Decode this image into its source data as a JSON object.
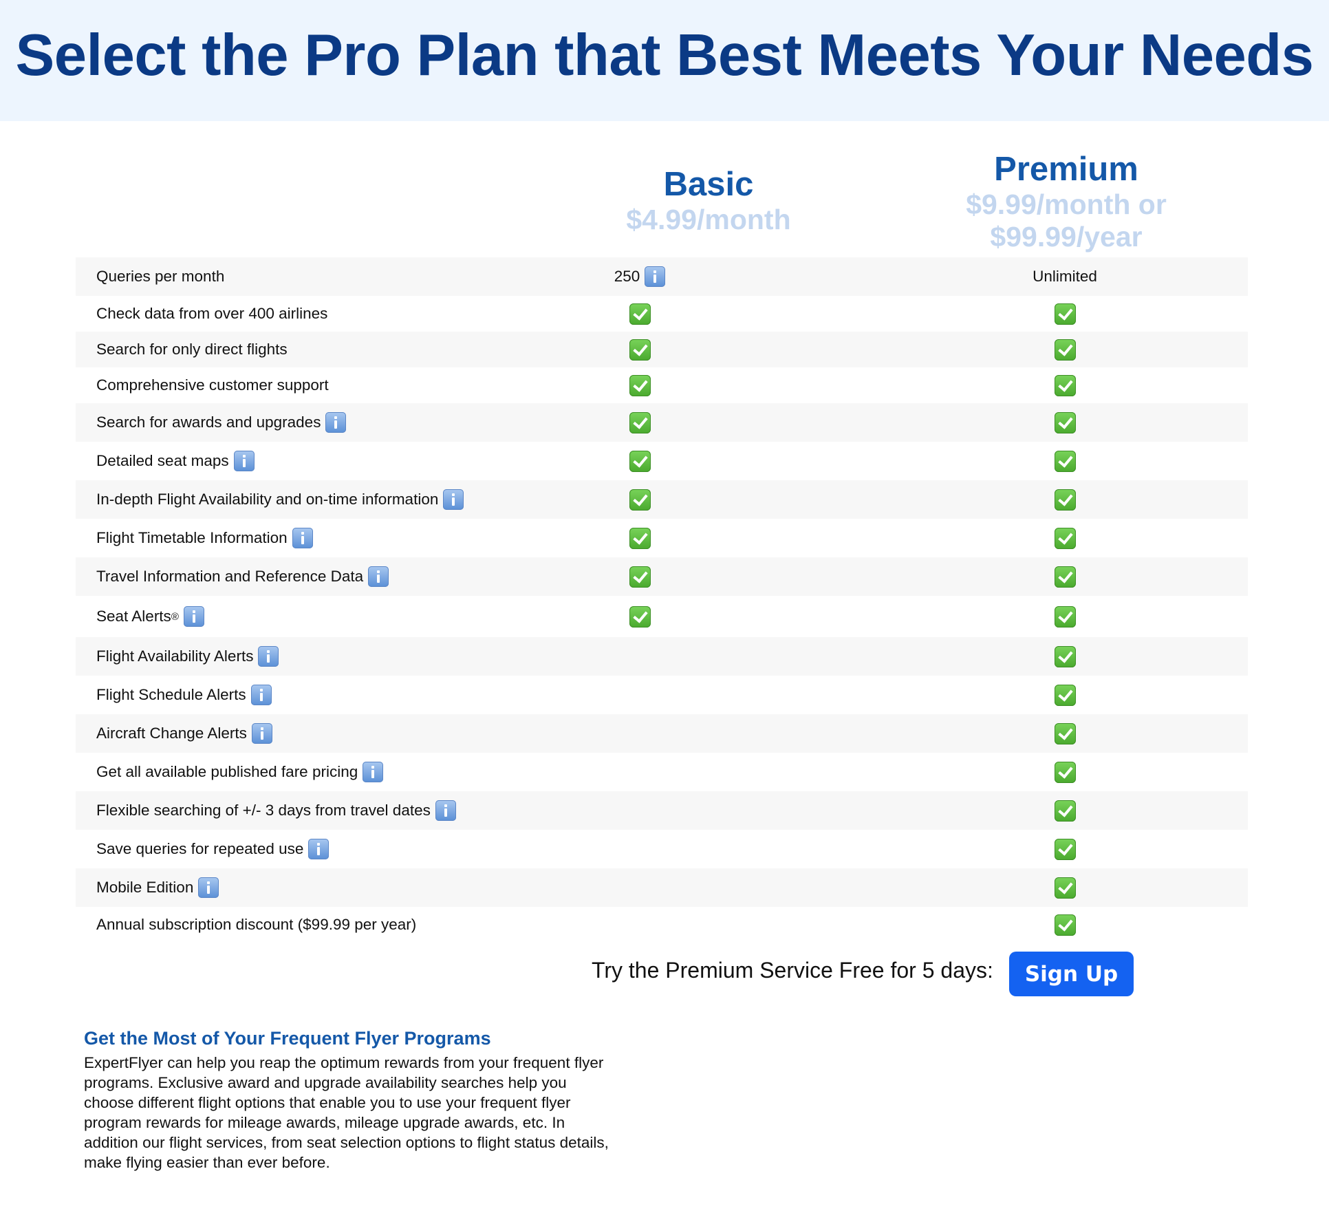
{
  "header": {
    "title": "Select the Pro Plan that Best Meets Your Needs"
  },
  "plans": [
    {
      "name": "Basic",
      "price_line1": "$4.99/month",
      "price_line2": ""
    },
    {
      "name": "Premium",
      "price_line1": "$9.99/month or",
      "price_line2": "$99.99/year"
    }
  ],
  "features": [
    {
      "label": "Queries per month",
      "info": false,
      "basic": "250",
      "basic_info": true,
      "premium": "Unlimited"
    },
    {
      "label": "Check data from over 400 airlines",
      "info": false,
      "basic": "check",
      "premium": "check"
    },
    {
      "label": "Search for only direct flights",
      "info": false,
      "basic": "check",
      "premium": "check"
    },
    {
      "label": "Comprehensive customer support",
      "info": false,
      "basic": "check",
      "premium": "check"
    },
    {
      "label": "Search for awards and upgrades",
      "info": true,
      "basic": "check",
      "premium": "check"
    },
    {
      "label": "Detailed seat maps",
      "info": true,
      "basic": "check",
      "premium": "check"
    },
    {
      "label": "In-depth Flight Availability and on-time information",
      "info": true,
      "basic": "check",
      "premium": "check"
    },
    {
      "label": "Flight Timetable Information",
      "info": true,
      "basic": "check",
      "premium": "check"
    },
    {
      "label": "Travel Information and Reference Data",
      "info": true,
      "basic": "check",
      "premium": "check"
    },
    {
      "label": "Seat Alerts",
      "sup": "®",
      "info": true,
      "basic": "check",
      "premium": "check"
    },
    {
      "label": "Flight Availability Alerts",
      "info": true,
      "basic": "",
      "premium": "check"
    },
    {
      "label": "Flight Schedule Alerts",
      "info": true,
      "basic": "",
      "premium": "check"
    },
    {
      "label": "Aircraft Change Alerts",
      "info": true,
      "basic": "",
      "premium": "check"
    },
    {
      "label": "Get all available published fare pricing",
      "info": true,
      "basic": "",
      "premium": "check"
    },
    {
      "label": "Flexible searching of +/- 3 days from travel dates",
      "info": true,
      "basic": "",
      "premium": "check"
    },
    {
      "label": "Save queries for repeated use",
      "info": true,
      "basic": "",
      "premium": "check"
    },
    {
      "label": "Mobile Edition",
      "info": true,
      "basic": "",
      "premium": "check"
    },
    {
      "label": "Annual subscription discount ($99.99 per year)",
      "info": false,
      "basic": "",
      "premium": "check"
    }
  ],
  "cta": {
    "text": "Try the Premium Service Free for 5 days:",
    "button": "Sign Up"
  },
  "about": {
    "title": "Get the Most of Your Frequent Flyer Programs",
    "lines": [
      "ExpertFlyer can help you reap the optimum rewards from your frequent flyer",
      "programs. Exclusive award and upgrade availability searches help you",
      "choose different flight options that enable you to use your frequent flyer",
      "program rewards for mileage awards, mileage upgrade awards, etc. In",
      "addition our flight services, from seat selection options to flight status details,",
      "make flying easier than ever before."
    ]
  },
  "colors": {
    "header_bg": "#edf5fe",
    "title": "#0b3a85",
    "plan_name": "#1458a8",
    "price": "#c3d6ef",
    "button": "#1462f1"
  }
}
